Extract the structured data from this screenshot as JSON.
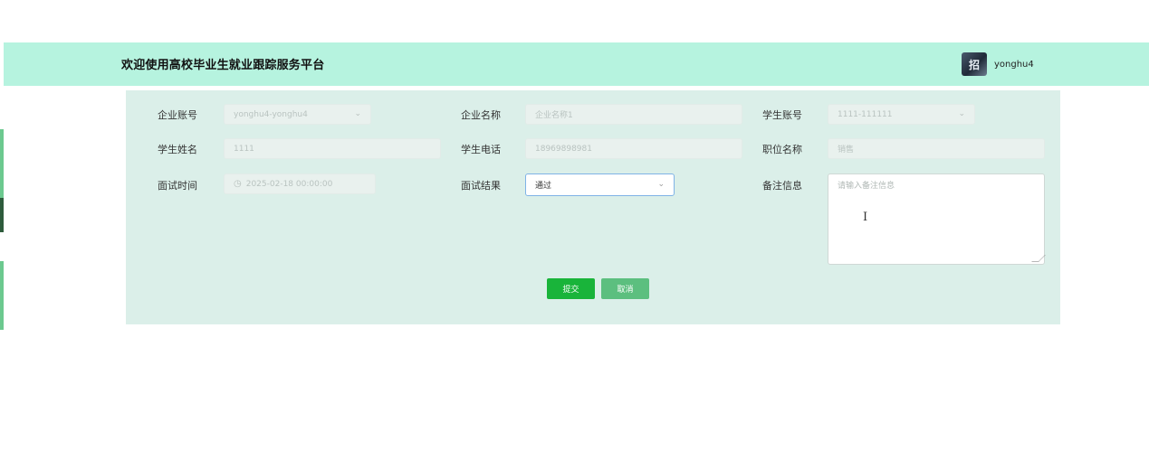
{
  "header": {
    "title": "欢迎使用高校毕业生就业跟踪服务平台",
    "avatar_text": "招",
    "username": "yonghu4"
  },
  "form": {
    "company_account": {
      "label": "企业账号",
      "value": "yonghu4-yonghu4"
    },
    "company_name": {
      "label": "企业名称",
      "placeholder": "企业名称1"
    },
    "student_account": {
      "label": "学生账号",
      "value": "1111-111111"
    },
    "student_name": {
      "label": "学生姓名",
      "value": "1111"
    },
    "student_phone": {
      "label": "学生电话",
      "value": "18969898981"
    },
    "position_name": {
      "label": "职位名称",
      "value": "销售"
    },
    "interview_time": {
      "label": "面试时间",
      "value": "2025-02-18 00:00:00"
    },
    "interview_result": {
      "label": "面试结果",
      "value": "通过"
    },
    "remarks": {
      "label": "备注信息",
      "placeholder": "请输入备注信息"
    }
  },
  "buttons": {
    "submit": "提交",
    "cancel": "取消"
  },
  "icons": {
    "chevron": "chevron-down-icon",
    "clock": "clock-icon"
  }
}
